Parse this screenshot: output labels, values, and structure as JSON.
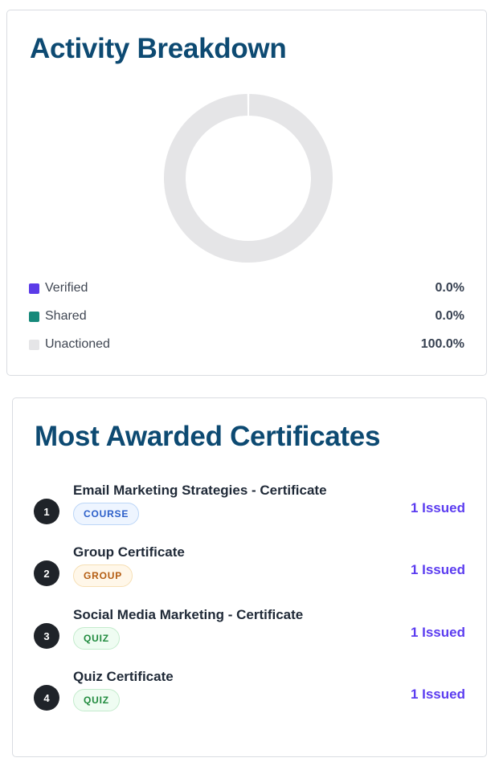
{
  "activity": {
    "title": "Activity Breakdown",
    "legend": [
      {
        "label": "Verified",
        "value": "0.0%",
        "color": "#5b3be8"
      },
      {
        "label": "Shared",
        "value": "0.0%",
        "color": "#16897a"
      },
      {
        "label": "Unactioned",
        "value": "100.0%",
        "color": "#e5e5e7"
      }
    ],
    "chart_data": {
      "type": "pie",
      "variant": "donut",
      "categories": [
        "Verified",
        "Shared",
        "Unactioned"
      ],
      "values": [
        0.0,
        0.0,
        100.0
      ],
      "colors": [
        "#5b3be8",
        "#16897a",
        "#e5e5e7"
      ]
    }
  },
  "certificates": {
    "title": "Most Awarded Certificates",
    "items": [
      {
        "rank": "1",
        "name": "Email Marketing Strategies - Certificate",
        "type": "COURSE",
        "type_key": "course",
        "issued": "1 Issued"
      },
      {
        "rank": "2",
        "name": "Group Certificate",
        "type": "GROUP",
        "type_key": "group",
        "issued": "1 Issued"
      },
      {
        "rank": "3",
        "name": "Social Media Marketing - Certificate",
        "type": "QUIZ",
        "type_key": "quiz",
        "issued": "1 Issued"
      },
      {
        "rank": "4",
        "name": "Quiz Certificate",
        "type": "QUIZ",
        "type_key": "quiz",
        "issued": "1 Issued"
      }
    ]
  },
  "colors": {
    "title": "#0d4a72",
    "issued": "#5b3cf0",
    "rank_badge": "#1f2329"
  }
}
